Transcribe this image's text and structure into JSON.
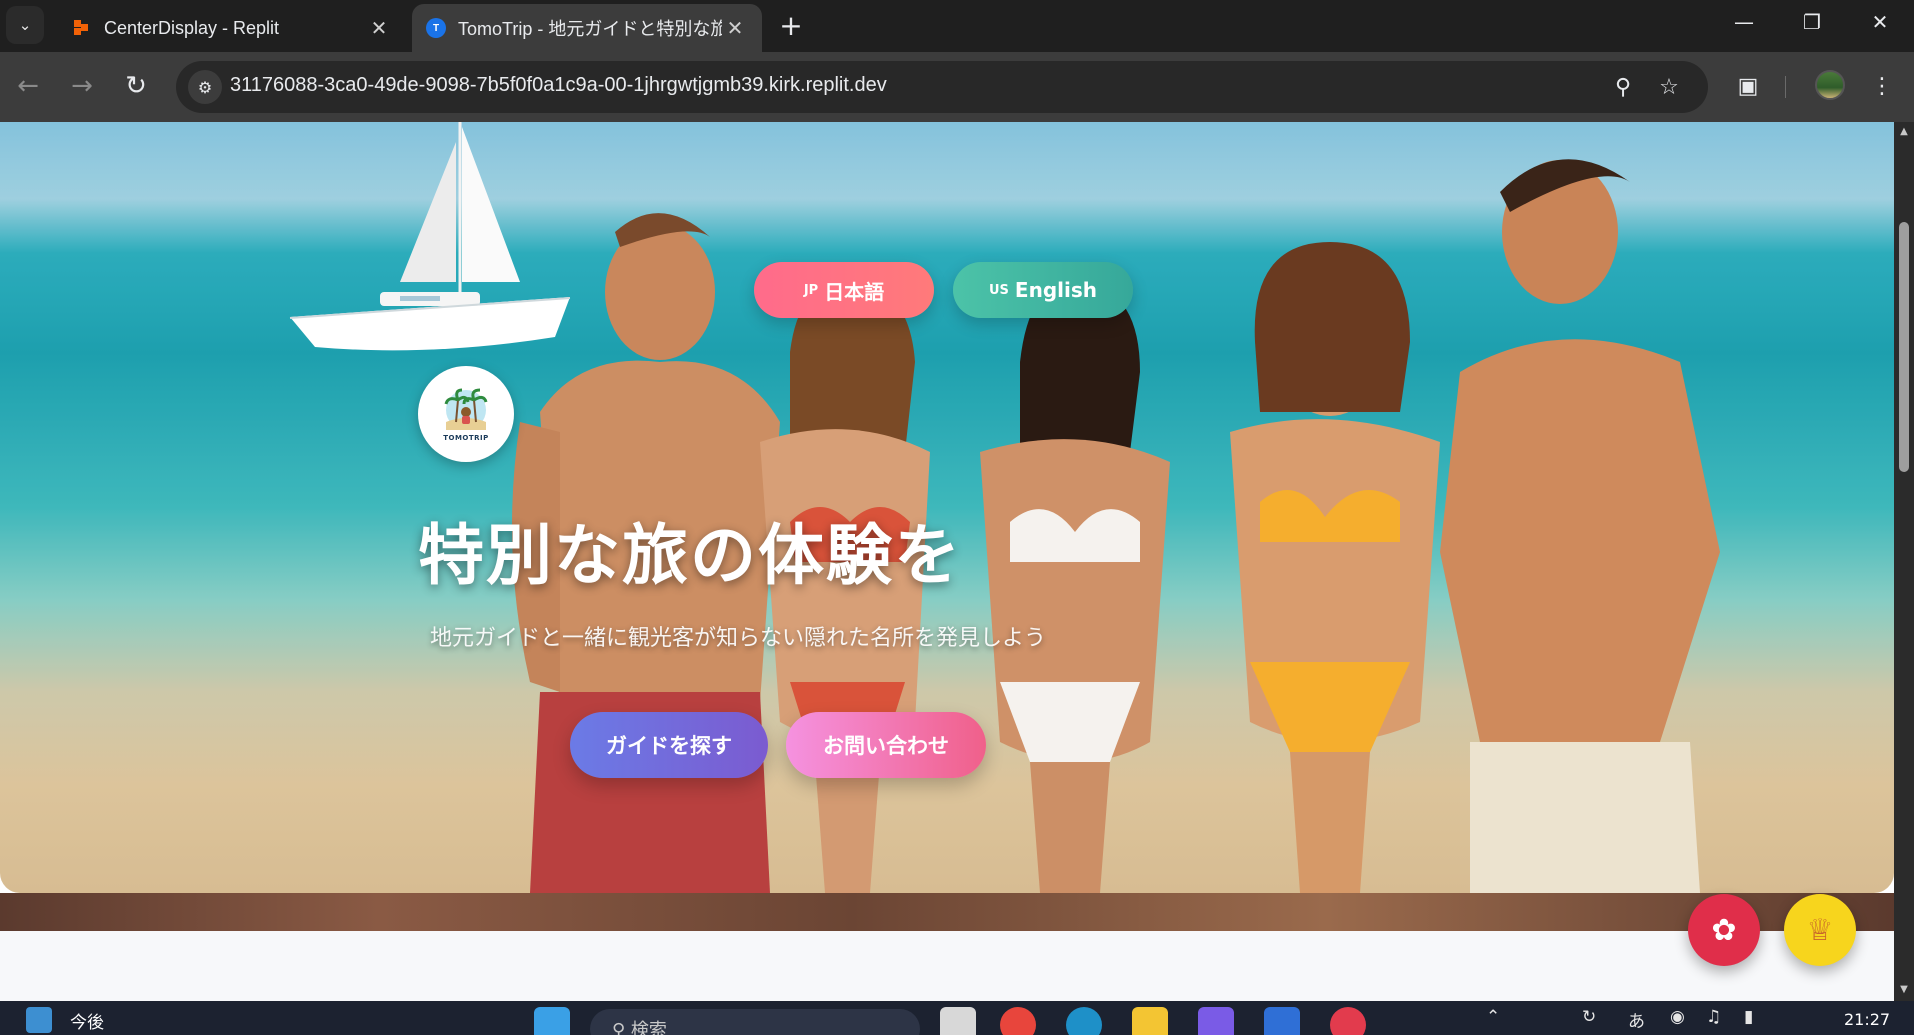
{
  "browser": {
    "tabs": [
      {
        "title": "CenterDisplay - Replit",
        "active": false,
        "favicon": "replit-icon"
      },
      {
        "title": "TomoTrip - 地元ガイドと特別な旅",
        "active": true,
        "favicon": "tomotrip-icon",
        "favicon_letter": "T"
      }
    ],
    "url": "31176088-3ca0-49de-9098-7b5f0f0a1c9a-00-1jhrgwtjgmb39.kirk.replit.dev"
  },
  "page": {
    "language_buttons": {
      "jp": {
        "flag": "JP",
        "label": "日本語"
      },
      "en": {
        "flag": "US",
        "label": "English"
      }
    },
    "logo_text": "TOMOTRIP",
    "hero_title": "特別な旅の体験を",
    "hero_subtitle": "地元ガイドと一緒に観光客が知らない隠れた名所を発見しよう",
    "cta_find_guide": "ガイドを探す",
    "cta_contact": "お問い合わせ"
  },
  "taskbar": {
    "widget_text": "今後",
    "search_placeholder": "検索",
    "ime_indicator": "あ",
    "clock": "21:27"
  },
  "colors": {
    "jp_button": "#ff6b8b",
    "en_button": "#4cc3a8",
    "guide_button": "#6b7be6",
    "contact_button": "#f0608a",
    "settings_fab": "#e02e4a",
    "trophy_fab": "#f7d51d"
  }
}
